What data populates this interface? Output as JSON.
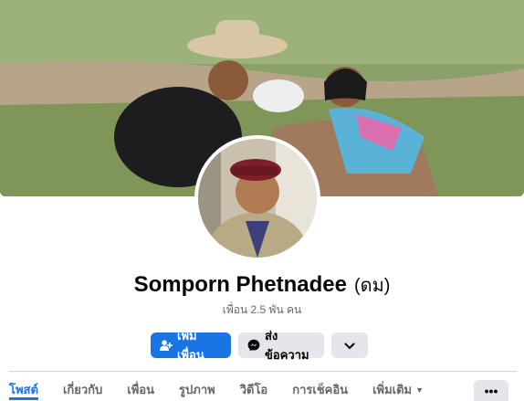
{
  "profile": {
    "name": "Somporn Phetnadee",
    "nickname": "(ดม)",
    "friends_text": "เพื่อน 2.5 พัน คน"
  },
  "actions": {
    "add_friend": "เพิ่มเพื่อน",
    "message": "ส่งข้อความ"
  },
  "tabs": [
    {
      "label": "โพสต์"
    },
    {
      "label": "เกี่ยวกับ"
    },
    {
      "label": "เพื่อน"
    },
    {
      "label": "รูปภาพ"
    },
    {
      "label": "วิดีโอ"
    },
    {
      "label": "การเช็คอิน"
    },
    {
      "label": "เพิ่มเติม"
    }
  ],
  "more_menu": "•••",
  "colors": {
    "accent": "#1b74e4",
    "secondary_button": "#e4e6eb",
    "muted_text": "#65676b"
  },
  "icons": [
    "add-friend-icon",
    "messenger-icon",
    "chevron-down-icon",
    "caret-down-icon",
    "more-dots-icon"
  ]
}
